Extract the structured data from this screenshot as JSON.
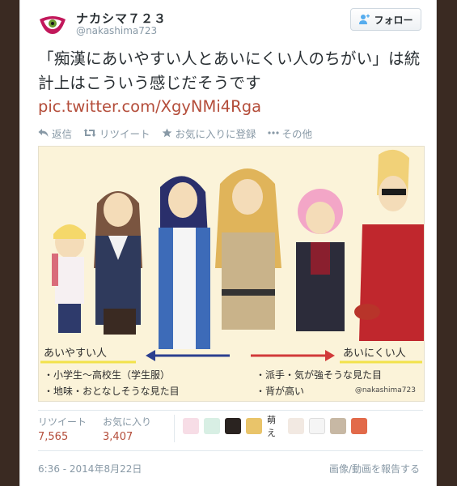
{
  "profile": {
    "name": "ナカシマ７２３",
    "handle": "@nakashima723",
    "follow_label": "フォロー",
    "avatar_icon": "eye-logo-icon"
  },
  "tweet": {
    "text": "「痴漢にあいやすい人とあいにくい人のちがい」は統計上はこういう感じだそうです",
    "link": "pic.twitter.com/XgyNMi4Rga"
  },
  "actions": [
    {
      "label": "返信",
      "icon": "reply-icon"
    },
    {
      "label": "リツイート",
      "icon": "retweet-icon"
    },
    {
      "label": "お気に入りに登録",
      "icon": "star-icon"
    },
    {
      "label": "その他",
      "icon": "more-icon"
    }
  ],
  "media": {
    "caption_left": "あいやすい人",
    "caption_right": "あいにくい人",
    "list_left": [
      "・小学生～高校生（学生服）",
      "・地味・おとなしそうな見た目"
    ],
    "list_right": [
      "・派手・気が強そうな見た目",
      "・背が高い"
    ],
    "watermark": "@nakashima723"
  },
  "stats": {
    "retweets_label": "リツイート",
    "retweets_value": "7,565",
    "favorites_label": "お気に入り",
    "favorites_value": "3,407",
    "favoriter_emoji_text": "萌え"
  },
  "footer": {
    "timestamp": "6:36 - 2014年8月22日",
    "report": "画像/動画を報告する"
  },
  "colors": {
    "link": "#b44d3a",
    "muted": "#8899a6",
    "text": "#292f33",
    "page_bg": "#3a2a22"
  }
}
